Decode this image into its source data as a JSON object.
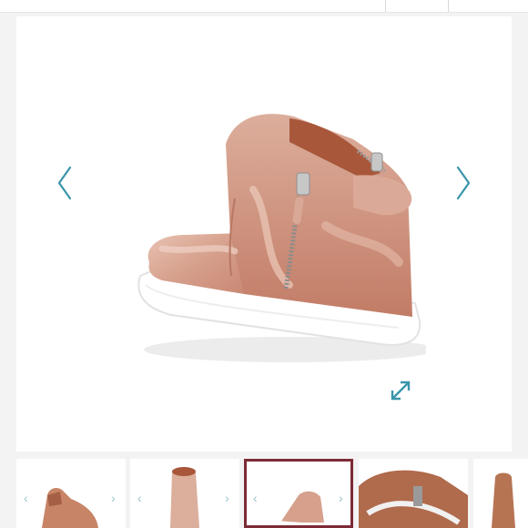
{
  "gallery": {
    "product_image_alt": "",
    "selected_index": 2,
    "thumbnail_count": 5,
    "accent_color": "#3a95aa",
    "selected_border_color": "#7d2a37",
    "icons": {
      "prev": "chevron-left-icon",
      "next": "chevron-right-icon",
      "expand": "expand-arrows-icon"
    }
  }
}
